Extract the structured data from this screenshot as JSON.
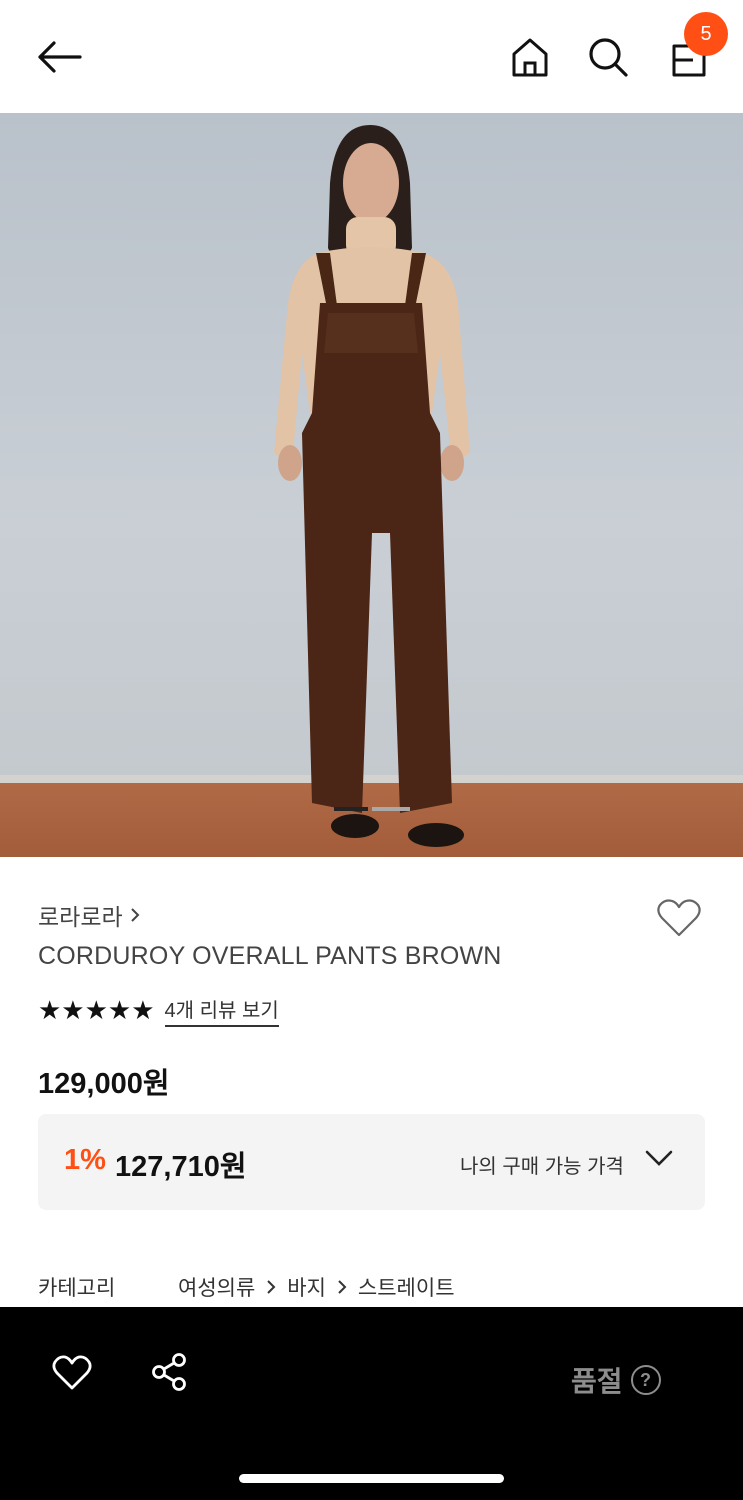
{
  "header": {
    "cart_count": "5",
    "icons": [
      "back-arrow-icon",
      "home-icon",
      "search-icon",
      "shopping-bag-icon"
    ]
  },
  "product": {
    "brand": "로라로라",
    "title": "CORDUROY OVERALL PANTS BROWN",
    "rating_stars": "★★★★★",
    "rating_value": 5,
    "review_link": "4개 리뷰 보기",
    "price": "129,000원",
    "discount_percent": "1%",
    "discount_price": "127,710원",
    "my_price_label": "나의 구매 가능 가격",
    "image_index": 1,
    "image_count": 2
  },
  "category": {
    "label": "카테고리",
    "path": [
      "여성의류",
      "바지",
      "스트레이트"
    ]
  },
  "bottom_bar": {
    "soldout_label": "품절",
    "help_glyph": "?"
  },
  "colors": {
    "accent": "#ff4f14",
    "bottom_bar": "#000000",
    "soldout_text": "#8d8d8d",
    "benefit_bg": "#f4f4f4"
  }
}
